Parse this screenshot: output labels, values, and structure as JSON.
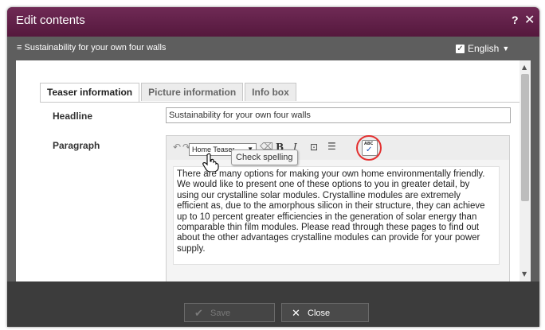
{
  "dialog": {
    "title": "Edit contents",
    "help": "?",
    "close": "✕"
  },
  "subbar": {
    "menu_icon": "≡",
    "doc_name": "Sustainability for your own four walls",
    "language": "English",
    "language_checked": true
  },
  "tabs": [
    {
      "label": "Teaser information",
      "active": true
    },
    {
      "label": "Picture information",
      "active": false
    },
    {
      "label": "Info box",
      "active": false
    }
  ],
  "form": {
    "headline_label": "Headline",
    "headline_value": "Sustainability for your own four walls",
    "paragraph_label": "Paragraph",
    "style_select": "Home Teaser",
    "paragraph_text": "There are many options for making your own home environmentally friendly. We would like to present one of these options to you in greater detail, by using our crystalline solar modules. Crystalline modules are extremely efficient as, due to the amorphous silicon in their structure, they can achieve up to 10 percent greater efficiencies in the generation of solar energy than comparable thin film modules. Please read through these pages to find out about the other advantages crystalline modules can provide for your power supply."
  },
  "toolbar": {
    "undo_icon": "undo-icon",
    "redo_icon": "redo-icon",
    "clear_format_icon": "eraser-icon",
    "bold": "B",
    "italic": "I",
    "insert_link_icon": "link-icon",
    "list_icon": "list-icon",
    "spellcheck_label": "ABC",
    "spellcheck_tooltip": "Check spelling"
  },
  "footer": {
    "save_label": "Save",
    "close_label": "Close"
  },
  "colors": {
    "titlebar": "#5f1f47",
    "highlight_ring": "#e33030",
    "footer": "#3c3c3c"
  }
}
